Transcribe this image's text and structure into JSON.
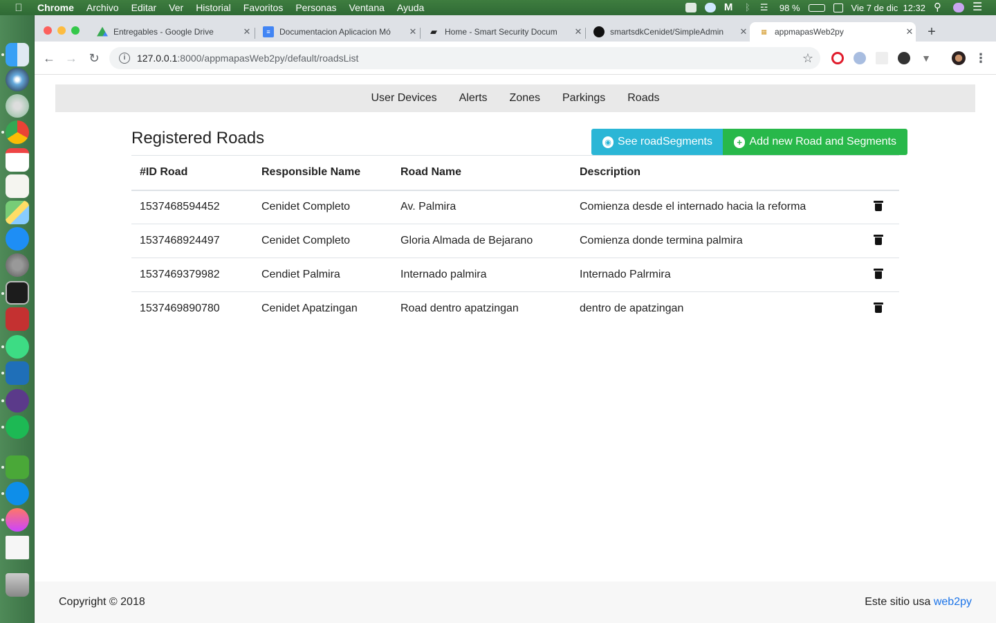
{
  "menubar": {
    "apple_icon": "apple-icon",
    "items": [
      "Chrome",
      "Archivo",
      "Editar",
      "Ver",
      "Historial",
      "Favoritos",
      "Personas",
      "Ventana",
      "Ayuda"
    ],
    "battery": "98 %",
    "clock": "Vie 7 de dic  12:32"
  },
  "tabs": [
    {
      "label": "Entregables - Google Drive",
      "icon": "google-drive-icon"
    },
    {
      "label": "Documentacion Aplicacion Mó",
      "icon": "google-docs-icon"
    },
    {
      "label": "Home - Smart Security Docum",
      "icon": "book-icon"
    },
    {
      "label": "smartsdkCenidet/SimpleAdmin",
      "icon": "github-icon"
    },
    {
      "label": "appmapasWeb2py",
      "icon": "web2py-icon",
      "active": true
    }
  ],
  "address": {
    "host": "127.0.0.1",
    "rest": ":8000/appmapasWeb2py/default/roadsList"
  },
  "navbar": {
    "links": [
      "User Devices",
      "Alerts",
      "Zones",
      "Parkings",
      "Roads"
    ]
  },
  "main": {
    "title": "Registered Roads",
    "see_button": "See roadSegments",
    "add_button": "Add new Road and Segments"
  },
  "table": {
    "headers": [
      "#ID Road",
      "Responsible Name",
      "Road Name",
      "Description"
    ],
    "rows": [
      [
        "1537468594452",
        "Cenidet Completo",
        "Av. Palmira",
        "Comienza desde el internado hacia la reforma"
      ],
      [
        "1537468924497",
        "Cenidet Completo",
        "Gloria Almada de Bejarano",
        "Comienza donde termina palmira"
      ],
      [
        "1537469379982",
        "Cendiet Palmira",
        "Internado palmira",
        "Internado Palrmira"
      ],
      [
        "1537469890780",
        "Cenidet Apatzingan",
        "Road dentro apatzingan",
        "dentro de apatzingan"
      ]
    ]
  },
  "footer": {
    "copyright": "Copyright © 2018",
    "powered_prefix": "Este sitio usa",
    "powered_link": "web2py"
  },
  "colors": {
    "see_button": "#2bb6d6",
    "add_button": "#28b84a",
    "navbar": "#e9e9e9",
    "link": "#1a73e8"
  }
}
